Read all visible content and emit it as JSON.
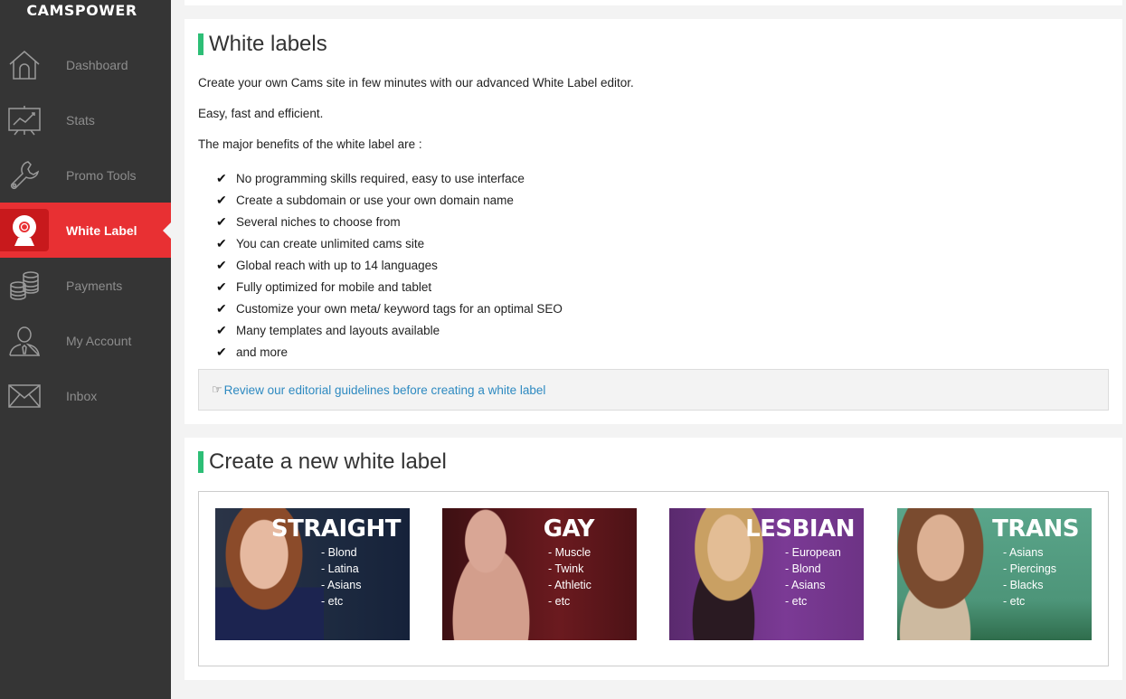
{
  "sidebar": {
    "logo": "CAMSPOWER",
    "items": [
      {
        "label": "Dashboard",
        "icon": "home-icon",
        "active": false
      },
      {
        "label": "Stats",
        "icon": "chart-board-icon",
        "active": false
      },
      {
        "label": "Promo Tools",
        "icon": "wrench-icon",
        "active": false
      },
      {
        "label": "White Label",
        "icon": "webcam-icon",
        "active": true
      },
      {
        "label": "Payments",
        "icon": "coins-icon",
        "active": false
      },
      {
        "label": "My Account",
        "icon": "user-icon",
        "active": false
      },
      {
        "label": "Inbox",
        "icon": "envelope-icon",
        "active": false
      }
    ]
  },
  "white_labels": {
    "title": "White labels",
    "intro": "Create your own Cams site in few minutes with our advanced White Label editor.",
    "tagline": "Easy, fast and efficient.",
    "benefits_intro": "The major benefits of the white label are :",
    "benefits": [
      "No programming skills required, easy to use interface",
      "Create a subdomain or use your own domain name",
      "Several niches to choose from",
      "You can create unlimited cams site",
      "Global reach with up to 14 languages",
      "Fully optimized for mobile and tablet",
      "Customize your own meta/ keyword tags for an optimal SEO",
      "Many templates and layouts available",
      "and more"
    ],
    "check_glyph": "✔",
    "notice_icon": "☞",
    "notice_link": "Review our editorial guidelines before creating a white label"
  },
  "create": {
    "title": "Create a new white label",
    "cards": [
      {
        "title": "STRAIGHT",
        "niches": [
          "- Blond",
          "- Latina",
          "- Asians",
          "- etc"
        ],
        "color": "#1d2a40"
      },
      {
        "title": "GAY",
        "niches": [
          "- Muscle",
          "- Twink",
          "- Athletic",
          "- etc"
        ],
        "color": "#6b1a1f"
      },
      {
        "title": "LESBIAN",
        "niches": [
          "- European",
          "- Blond",
          "- Asians",
          "- etc"
        ],
        "color": "#7b3a95"
      },
      {
        "title": "TRANS",
        "niches": [
          "- Asians",
          "- Piercings",
          "- Blacks",
          "- etc"
        ],
        "color": "#4d9579"
      }
    ]
  }
}
